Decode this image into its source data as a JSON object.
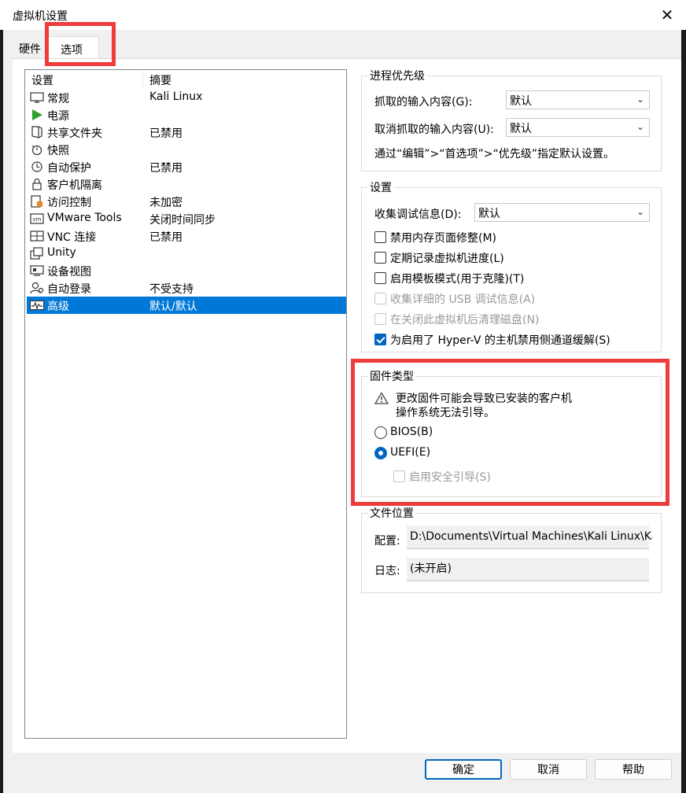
{
  "window": {
    "title": "虚拟机设置",
    "close_glyph": "✕"
  },
  "tabs": [
    {
      "label": "硬件",
      "active": false
    },
    {
      "label": "选项",
      "active": true
    }
  ],
  "list": {
    "headers": {
      "setting": "设置",
      "summary": "摘要"
    },
    "rows": [
      {
        "name": "常规",
        "summary": "Kali Linux",
        "icon": "monitor-icon"
      },
      {
        "name": "电源",
        "summary": "",
        "icon": "power-play-icon"
      },
      {
        "name": "共享文件夹",
        "summary": "已禁用",
        "icon": "shared-folder-icon"
      },
      {
        "name": "快照",
        "summary": "",
        "icon": "snapshot-icon"
      },
      {
        "name": "自动保护",
        "summary": "已禁用",
        "icon": "autoprotect-clock-icon"
      },
      {
        "name": "客户机隔离",
        "summary": "",
        "icon": "lock-icon"
      },
      {
        "name": "访问控制",
        "summary": "未加密",
        "icon": "access-control-icon"
      },
      {
        "name": "VMware Tools",
        "summary": "关闭时间同步",
        "icon": "vm-icon"
      },
      {
        "name": "VNC 连接",
        "summary": "已禁用",
        "icon": "vnc-icon"
      },
      {
        "name": "Unity",
        "summary": "",
        "icon": "unity-icon"
      },
      {
        "name": "设备视图",
        "summary": "",
        "icon": "device-view-icon"
      },
      {
        "name": "自动登录",
        "summary": "不受支持",
        "icon": "autologin-icon"
      },
      {
        "name": "高级",
        "summary": "默认/默认",
        "icon": "advanced-pulse-icon",
        "selected": true
      }
    ]
  },
  "priority": {
    "title": "进程优先级",
    "grab_label": "抓取的输入内容(G):",
    "grab_value": "默认",
    "ungrab_label": "取消抓取的输入内容(U):",
    "ungrab_value": "默认",
    "hint": "通过“编辑”>“首选项”>“优先级”指定默认设置。"
  },
  "settings": {
    "title": "设置",
    "debug_label": "收集调试信息(D):",
    "debug_value": "默认",
    "options": [
      {
        "label": "禁用内存页面修整(M)",
        "checked": false,
        "disabled": false
      },
      {
        "label": "定期记录虚拟机进度(L)",
        "checked": false,
        "disabled": false
      },
      {
        "label": "启用模板模式(用于克隆)(T)",
        "checked": false,
        "disabled": false
      },
      {
        "label": "收集详细的 USB 调试信息(A)",
        "checked": false,
        "disabled": true
      },
      {
        "label": "在关闭此虚拟机后清理磁盘(N)",
        "checked": false,
        "disabled": true
      },
      {
        "label": "为启用了 Hyper-V 的主机禁用侧通道缓解(S)",
        "checked": true,
        "disabled": false
      }
    ]
  },
  "firmware": {
    "title": "固件类型",
    "warning_line1": "更改固件可能会导致已安装的客户机",
    "warning_line2": "操作系统无法引导。",
    "bios_label": "BIOS(B)",
    "uefi_label": "UEFI(E)",
    "selected": "UEFI",
    "secure_boot_label": "启用安全引导(S)"
  },
  "file_location": {
    "title": "文件位置",
    "config_label": "配置:",
    "config_value": "D:\\Documents\\Virtual Machines\\Kali Linux\\Kali",
    "log_label": "日志:",
    "log_value": "(未开启)"
  },
  "buttons": {
    "ok": "确定",
    "cancel": "取消",
    "help": "帮助"
  },
  "colors": {
    "accent": "#0078d7",
    "annotation": "#ee3b3b"
  }
}
